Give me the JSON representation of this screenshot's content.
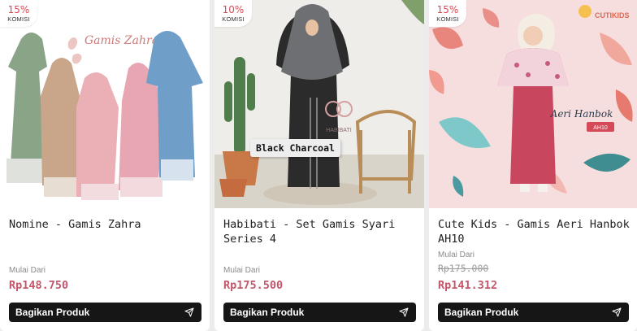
{
  "share_label": "Bagikan Produk",
  "products": [
    {
      "commission_pct": "15%",
      "commission_label": "KOMISI",
      "image_text": "Gamis Zahra",
      "title": "Nomine - Gamis Zahra",
      "from_label": "Mulai Dari",
      "price": "Rp148.750"
    },
    {
      "commission_pct": "10%",
      "commission_label": "KOMISI",
      "image_text": "Black Charcoal",
      "image_brand": "HABIBATI",
      "title": "Habibati - Set Gamis Syari Series 4",
      "from_label": "Mulai Dari",
      "price": "Rp175.500"
    },
    {
      "commission_pct": "15%",
      "commission_label": "KOMISI",
      "image_text": "Aeri Hanbok",
      "image_code": "AH10",
      "image_brand": "CUTIKIDS",
      "title": "Cute Kids - Gamis Aeri Hanbok AH10",
      "from_label": "Mulai Dari",
      "original_price": "Rp175.000",
      "price": "Rp141.312"
    }
  ],
  "colors": {
    "commission": "#d94a56",
    "price": "#c4566a",
    "button": "#161616"
  },
  "icons": {
    "share": "send-icon"
  }
}
